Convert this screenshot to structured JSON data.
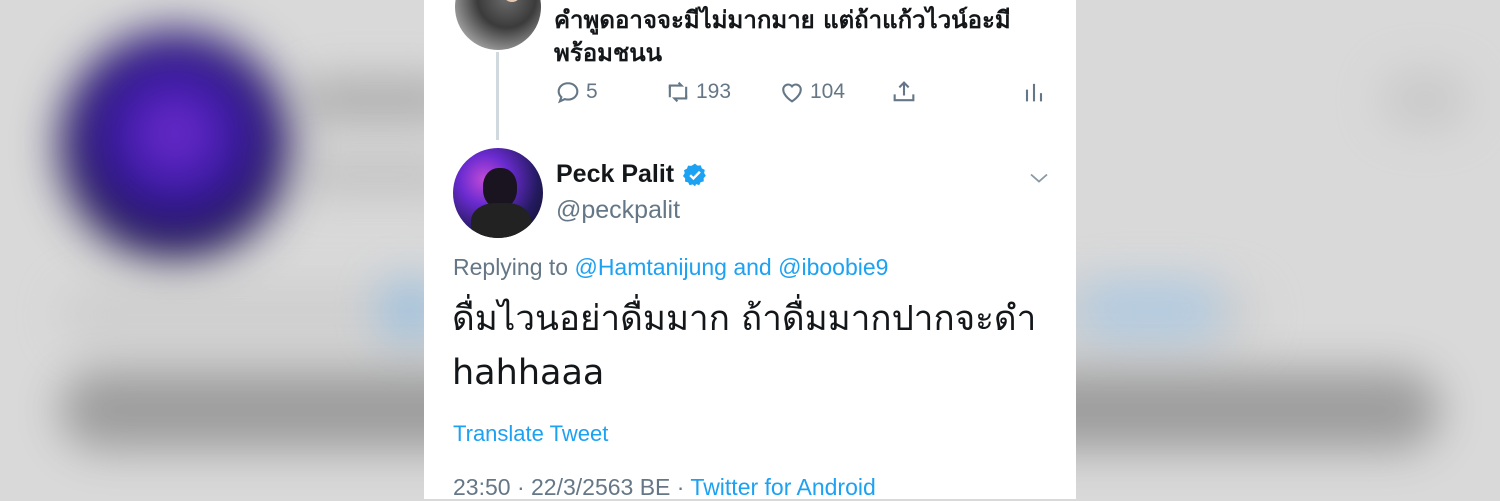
{
  "previous_tweet": {
    "text": "คำพูดอาจจะมีไม่มากมาย แต่ถ้าแก้วไวน์อะมีพร้อมชนน",
    "reply_count": "5",
    "retweet_count": "193",
    "like_count": "104"
  },
  "tweet": {
    "display_name": "Peck Palit",
    "handle": "@peckpalit",
    "replying_prefix": "Replying to",
    "replying_to_1": "@Hamtanijung",
    "replying_and": "and",
    "replying_to_2": "@iboobie9",
    "text_line1": "ดื่มไวนอย่าดื่มมาก ถ้าดื่มมากปากจะดำ",
    "text_line2": "hahhaaa",
    "translate_label": "Translate Tweet",
    "timestamp": "23:50 · 22/3/2563 BE ·",
    "source": "Twitter for Android"
  },
  "colors": {
    "accent": "#1da1f2",
    "text_primary": "#14171a",
    "text_secondary": "#657786"
  },
  "icons": [
    "reply-icon",
    "retweet-icon",
    "like-icon",
    "share-icon",
    "stats-icon",
    "verified-badge-icon",
    "chevron-down-icon"
  ]
}
